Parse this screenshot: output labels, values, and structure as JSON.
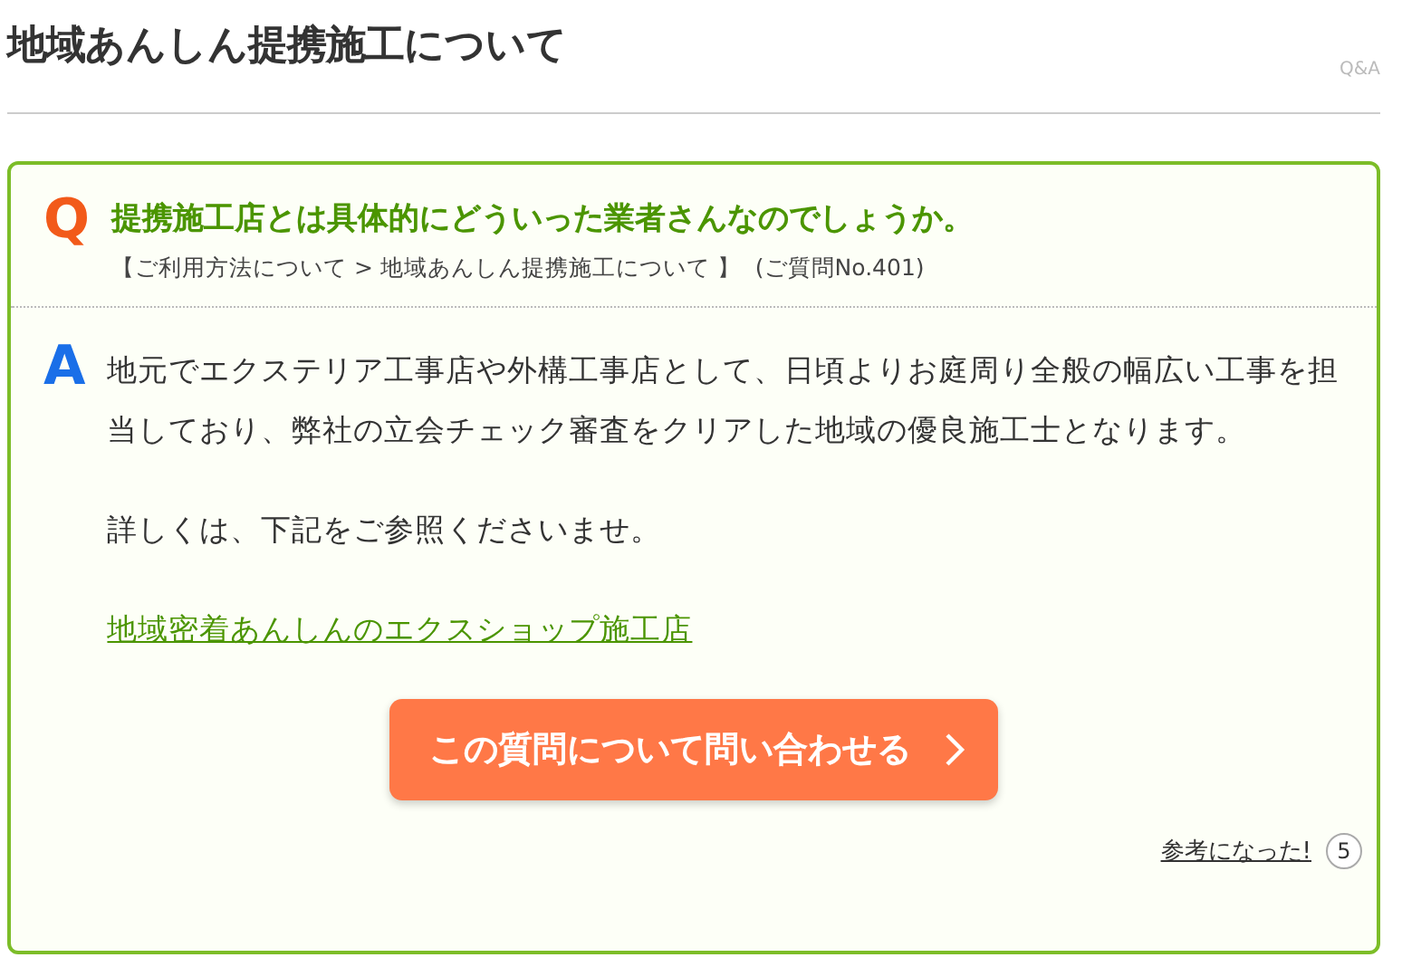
{
  "page_title": "地域あんしん提携施工について",
  "section_tag": "Q&A",
  "question": {
    "mark": "Q",
    "text": "提携施工店とは具体的にどういった業者さんなのでしょうか。",
    "category": "【ご利用方法について > 地域あんしん提携施工について 】",
    "number": "(ご質問No.401)"
  },
  "answer": {
    "mark": "A",
    "paragraphs": [
      "地元でエクステリア工事店や外構工事店として、日頃よりお庭周り全般の幅広い工事を担当しており、弊社の立会チェック審査をクリアした地域の優良施工士となります。",
      "詳しくは、下記をご参照くださいませ。"
    ],
    "link": "地域密着あんしんのエクスショップ施工店"
  },
  "contact_button": "この質問について問い合わせる",
  "helpful": {
    "label": "参考になった!",
    "count": "5"
  }
}
